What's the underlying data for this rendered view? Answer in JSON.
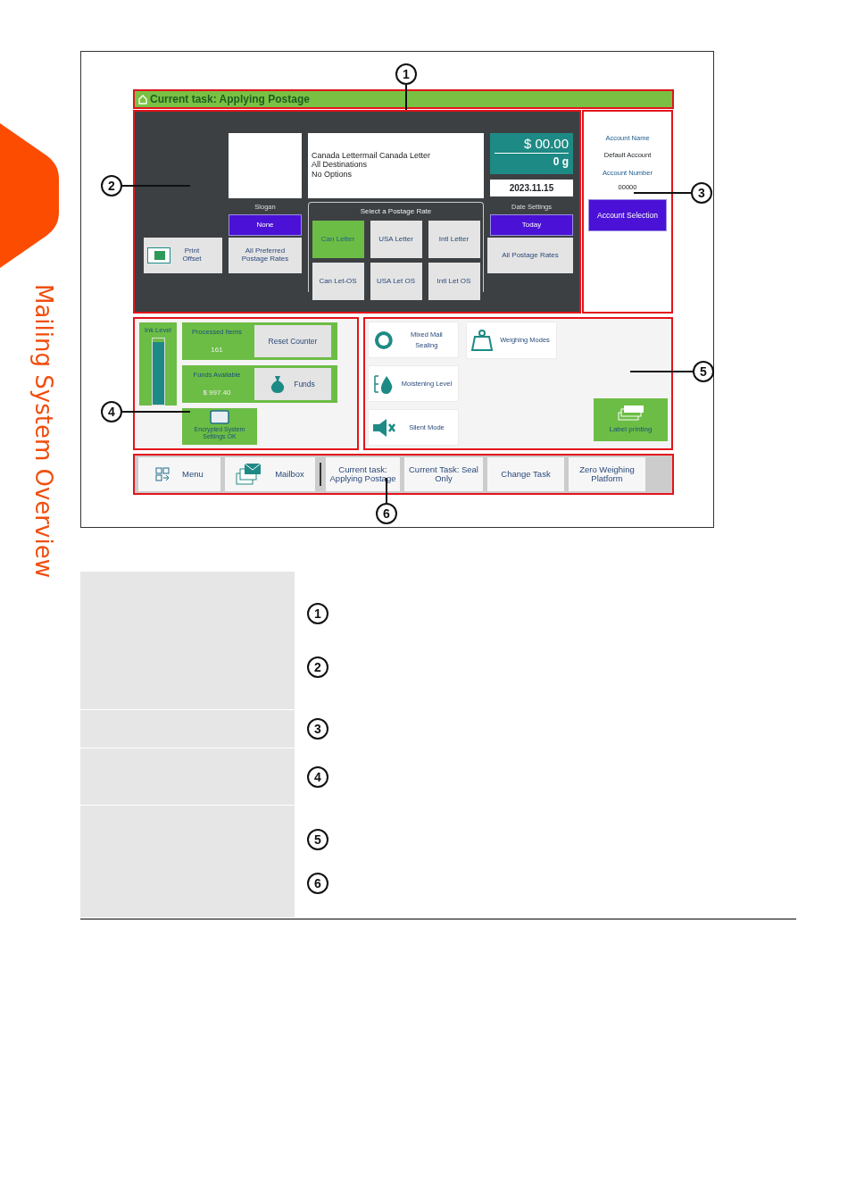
{
  "side_tab": {
    "title": "Mailing System Overview"
  },
  "app": {
    "task_bar": {
      "title": "Current task: Applying Postage"
    },
    "rate_info": {
      "lines": [
        "Canada Lettermail Canada Letter",
        "All Destinations",
        "No Options"
      ]
    },
    "postage": {
      "amount": "$ 00.00",
      "weight": "0 g",
      "date": "2023.11.15"
    },
    "slogan": {
      "label": "Slogan",
      "value": "None"
    },
    "rates": {
      "title": "Select a Postage Rate",
      "buttons": [
        {
          "label": "Can Letter",
          "selected": true
        },
        {
          "label": "USA Letter",
          "selected": false
        },
        {
          "label": "Intl Letter",
          "selected": false
        },
        {
          "label": "Can Let-OS",
          "selected": false
        },
        {
          "label": "USA Let OS",
          "selected": false
        },
        {
          "label": "Intl Let OS",
          "selected": false
        }
      ]
    },
    "date_settings": {
      "label": "Date Settings",
      "value": "Today"
    },
    "print_offset": "Print Offset",
    "preferred_rates": "All Preferred Postage Rates",
    "all_rates": "All Postage Rates",
    "account": {
      "name_label": "Account Name",
      "name": "Default Account",
      "number_label": "Account Number",
      "number": "00000",
      "button": "Account Selection"
    },
    "ink": {
      "label": "Ink Level",
      "level": 0.95
    },
    "counters": [
      {
        "label": "Processed Items",
        "value": "161",
        "button": "Reset Counter",
        "kind": "plain"
      },
      {
        "label": "Funds Available",
        "value": "$ 997.40",
        "button": "Funds",
        "kind": "funds"
      }
    ],
    "encryption": "Encrypted System Settings OK",
    "tools": [
      {
        "label": "Mixed Mail Sealing",
        "kind": "seal"
      },
      {
        "label": "Weighing Modes",
        "kind": "weight"
      },
      {
        "label": "Moistening Level",
        "kind": "drop"
      },
      {
        "label": "Silent Mode",
        "kind": "mute"
      }
    ],
    "label_printing": "Label printing",
    "nav": [
      {
        "label": "Menu",
        "kind": "menu"
      },
      {
        "label": "Mailbox",
        "kind": "mail"
      },
      {
        "label": "Current task: Applying Postage",
        "kind": "task"
      },
      {
        "label": "Current Task: Seal Only",
        "kind": "task"
      },
      {
        "label": "Change Task",
        "kind": "task"
      },
      {
        "label": "Zero Weighing Platform",
        "kind": "task"
      }
    ]
  },
  "callouts": [
    "1",
    "2",
    "3",
    "4",
    "5",
    "6"
  ],
  "legend": {
    "rows": [
      {
        "markers": [
          "1",
          "2"
        ]
      },
      {
        "markers": [
          "3"
        ]
      },
      {
        "markers": [
          "4"
        ]
      },
      {
        "markers": [
          "5",
          "6"
        ]
      }
    ]
  }
}
